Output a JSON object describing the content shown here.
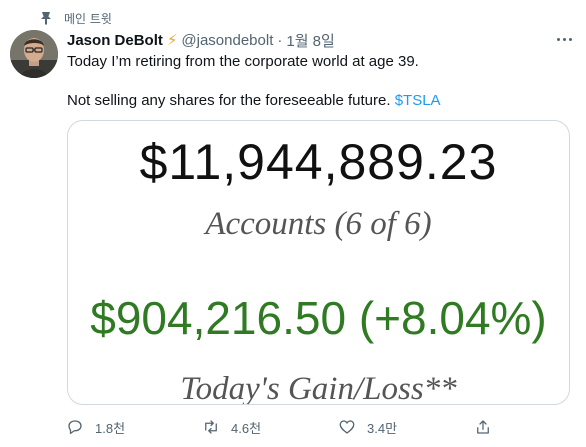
{
  "pinned": {
    "label": "메인 트윗",
    "icon": "pin-icon"
  },
  "tweet": {
    "author_name": "Jason DeBolt",
    "author_badge": "⚡",
    "handle": "@jasondebolt",
    "separator": "·",
    "date": "1월 8일",
    "text_line1": "Today I’m retiring from the corporate world at age 39.",
    "text_line2_prefix": "Not selling any shares for the foreseeable future. ",
    "cashtag": "$TSLA"
  },
  "media": {
    "total": "$11,944,889.23",
    "accounts_label": "Accounts (6 of 6)",
    "gain": "$904,216.50 (+8.04%)",
    "gain_label": "Today's Gain/Loss**",
    "colors": {
      "gain": "#2f7a22",
      "label": "#555555"
    }
  },
  "actions": {
    "reply_count": "1.8천",
    "retweet_count": "4.6천",
    "like_count": "3.4만"
  },
  "colors": {
    "link": "#1d9bf0",
    "secondary": "#536471",
    "bolt": "#f4a81d"
  }
}
